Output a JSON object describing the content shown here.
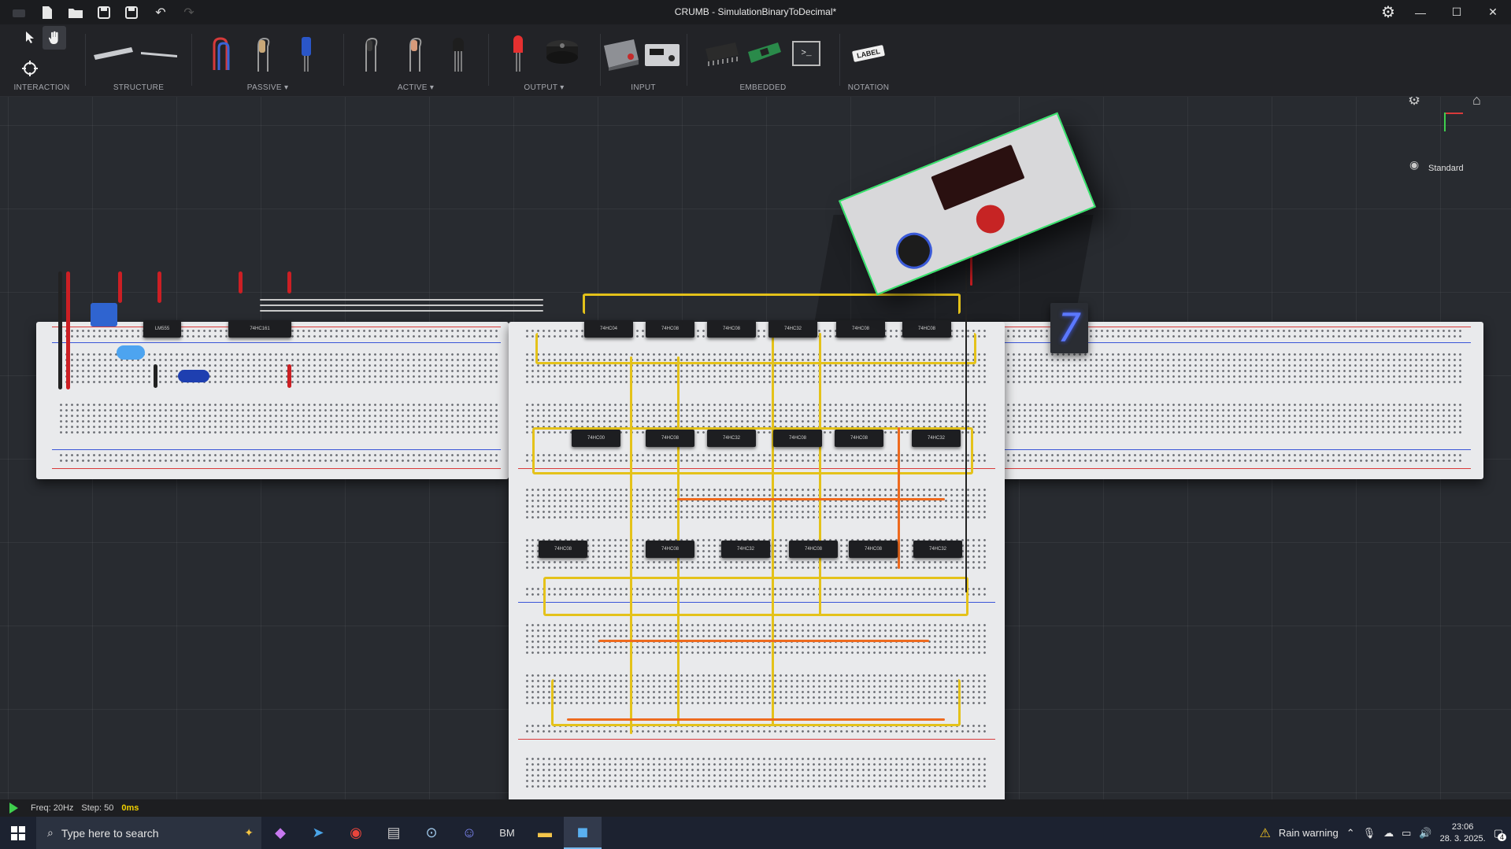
{
  "window": {
    "title": "CRUMB - SimulationBinaryToDecimal*",
    "min": "—",
    "max": "☐",
    "close": "✕"
  },
  "toolbar": {
    "groups": [
      {
        "label": "INTERACTION"
      },
      {
        "label": "STRUCTURE"
      },
      {
        "label": "PASSIVE ▾"
      },
      {
        "label": "ACTIVE ▾"
      },
      {
        "label": "OUTPUT ▾"
      },
      {
        "label": "INPUT"
      },
      {
        "label": "EMBEDDED"
      },
      {
        "label": "NOTATION"
      }
    ],
    "label_tool_text": "LABEL",
    "terminal_prompt": ">_"
  },
  "viewport": {
    "view_mode": "Standard",
    "seven_segment_digit": "7",
    "chips": [
      "74HC04",
      "74HC08",
      "74HC08",
      "74HC32",
      "74HC08",
      "74HC08",
      "74HC00",
      "74HC08",
      "74HC32",
      "74HC08",
      "74HC08",
      "74HC32",
      "74HC08",
      "74HC08",
      "74HC32",
      "74HC08",
      "74HC08",
      "74HC32"
    ],
    "left_chips": [
      "LM555",
      "74HC161"
    ]
  },
  "status": {
    "freq": "Freq: 20Hz",
    "step": "Step: 50",
    "ms": "0ms"
  },
  "taskbar": {
    "search_placeholder": "Type here to search",
    "weather": "Rain warning",
    "time": "23:06",
    "date": "28. 3. 2025.",
    "notifications": "4"
  },
  "colors": {
    "accent_green": "#35e26a",
    "wire_yellow": "#e4c21a",
    "wire_orange": "#ee6a1e",
    "wire_red": "#d81f24",
    "segment_blue": "#5b78ff"
  }
}
